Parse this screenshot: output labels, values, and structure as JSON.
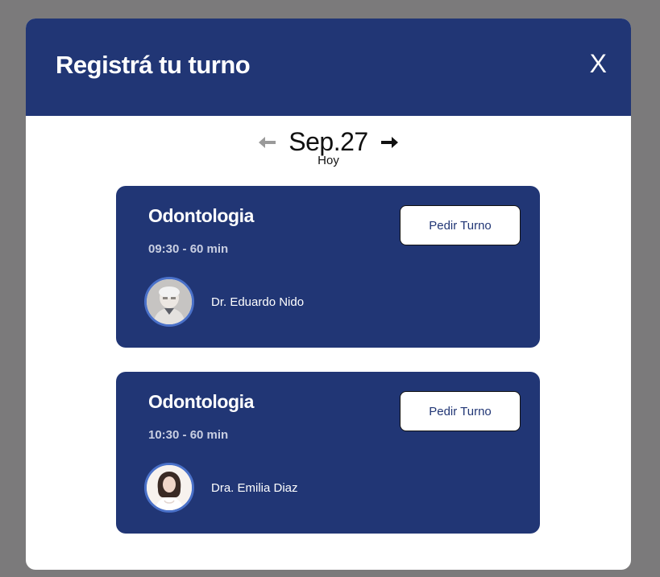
{
  "modal": {
    "title": "Registrá tu turno",
    "close_label": "X"
  },
  "date_nav": {
    "date": "Sep.27",
    "sub": "Hoy",
    "prev_icon": "arrow-left-icon",
    "next_icon": "arrow-right-icon"
  },
  "appointments": [
    {
      "specialty": "Odontologia",
      "time": "09:30 - 60 min",
      "button_label": "Pedir Turno",
      "doctor": "Dr. Eduardo Nido"
    },
    {
      "specialty": "Odontologia",
      "time": "10:30 - 60 min",
      "button_label": "Pedir Turno",
      "doctor": "Dra. Emilia Diaz"
    }
  ],
  "colors": {
    "primary": "#213675",
    "overlay": "#7b7a7b",
    "avatar_ring": "#4a71c9"
  }
}
